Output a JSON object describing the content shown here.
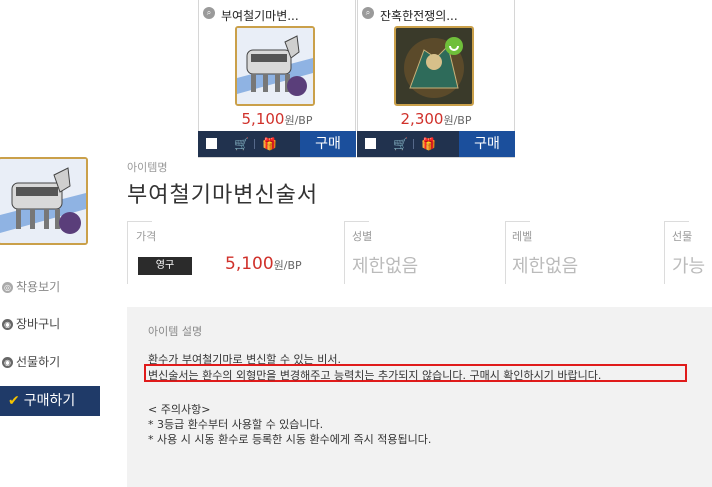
{
  "cards": [
    {
      "name": "부여철기마변...",
      "price": "5,100",
      "unit": "원/BP",
      "buy": "구매"
    },
    {
      "name": "잔혹한전쟁의...",
      "price": "2,300",
      "unit": "원/BP",
      "buy": "구매"
    }
  ],
  "item": {
    "category_label": "아이템명",
    "title": "부여철기마변신술서",
    "price_label": "가격",
    "period_tag": "영구",
    "price": "5,100",
    "price_unit": "원/BP",
    "gender_label": "성별",
    "gender_value": "제한없음",
    "level_label": "레벨",
    "level_value": "제한없음",
    "gift_label": "선물",
    "gift_value": "가능"
  },
  "side": {
    "wear": "착용보기",
    "cart": "장바구니",
    "gift": "선물하기",
    "buy": "구매하기"
  },
  "description": {
    "heading": "아이템 설명",
    "line1": "환수가 부여철기마로 변신할 수 있는 비서.",
    "line2": "변신술서는 환수의 외형만을 변경해주고 능력치는 추가되지 않습니다. 구매시 확인하시기 바랍니다.",
    "notice_title": "< 주의사항>",
    "notice1": "* 3등급 환수부터 사용할 수 있습니다.",
    "notice2": "* 사용 시 시동 환수로 등록한 시동 환수에게 즉시 적용됩니다."
  },
  "colors": {
    "price_red": "#d0312b",
    "buy_blue": "#1b4f9c",
    "bar_navy": "#21324e",
    "highlight_red": "#e01b1b"
  }
}
